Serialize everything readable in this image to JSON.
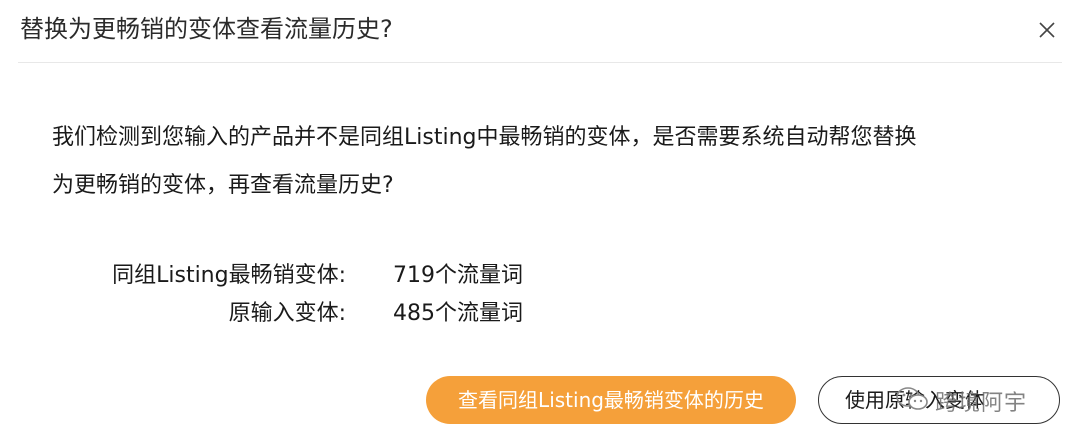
{
  "dialog": {
    "title": "替换为更畅销的变体查看流量历史?",
    "close_icon": "close-icon",
    "message_line1": "我们检测到您输入的产品并不是同组Listing中最畅销的变体，是否需要系统自动帮您替换",
    "message_line2": "为更畅销的变体，再查看流量历史?",
    "stats": [
      {
        "label": "同组Listing最畅销变体:",
        "value": "719个流量词"
      },
      {
        "label": "原输入变体:",
        "value": "485个流量词"
      }
    ],
    "primary_button": "查看同组Listing最畅销变体的历史",
    "secondary_button": "使用原输入变体",
    "accent_color": "#f5a03a"
  },
  "watermark": {
    "icon": "wechat-icon",
    "text": "跨境阿宇"
  }
}
